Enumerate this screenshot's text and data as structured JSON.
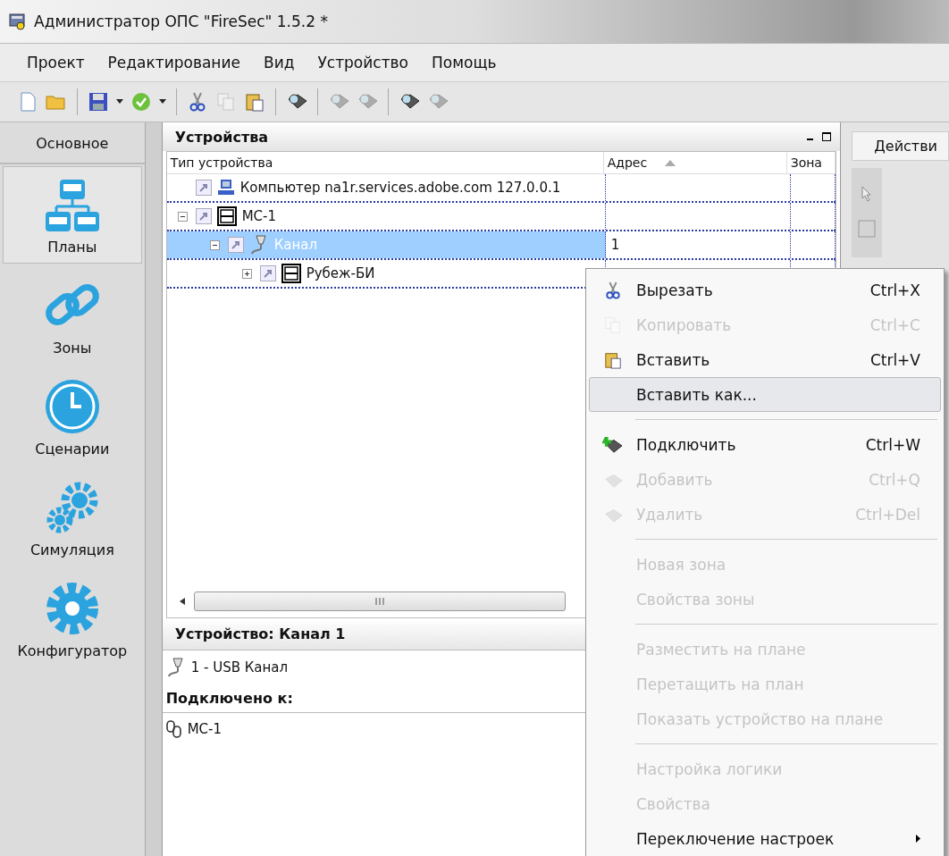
{
  "window": {
    "title": "Администратор ОПС \"FireSec\" 1.5.2 *"
  },
  "menu": [
    "Проект",
    "Редактирование",
    "Вид",
    "Устройство",
    "Помощь"
  ],
  "toolbar": [
    {
      "disabled": false
    },
    {
      "disabled": false
    },
    {
      "disabled": false
    },
    {
      "disabled": false
    },
    {
      "disabled": false
    },
    {
      "disabled": false
    },
    {
      "disabled": false
    },
    {
      "disabled": true
    },
    {
      "disabled": false
    },
    {
      "disabled": false
    },
    {
      "disabled": true
    },
    {
      "disabled": true
    },
    {
      "disabled": false
    },
    {
      "disabled": true
    }
  ],
  "sidebar": {
    "header": "Основное",
    "items": [
      {
        "label": "Планы",
        "selected": true
      },
      {
        "label": "Зоны",
        "selected": false
      },
      {
        "label": "Сценарии",
        "selected": false
      },
      {
        "label": "Симуляция",
        "selected": false
      },
      {
        "label": "Конфигуратор",
        "selected": false
      }
    ]
  },
  "devices": {
    "title": "Устройства",
    "columns": [
      {
        "label": "Тип устройства",
        "sorted": false
      },
      {
        "label": "Адрес",
        "sorted": true
      },
      {
        "label": "Зона",
        "sorted": false
      }
    ],
    "tree": [
      {
        "kind": "computer",
        "label": "Компьютер na1r.services.adobe.com 127.0.0.1",
        "selected": false
      },
      {
        "kind": "module",
        "label": "МС-1",
        "expanded": true,
        "selected": false,
        "children": [
          {
            "kind": "channel",
            "label": "Канал",
            "address": "1",
            "expanded": true,
            "selected": true,
            "children": [
              {
                "kind": "module",
                "label": "Рубеж-БИ",
                "expanded": false,
                "selected": false
              }
            ]
          }
        ]
      }
    ]
  },
  "details": {
    "title": "Устройство: Канал 1",
    "device": "1 - USB Канал",
    "connected_title": "Подключено к:",
    "connected": "МС-1"
  },
  "right_panel": {
    "tab": "Действи"
  },
  "context_menu": [
    {
      "kind": "item",
      "label": "Вырезать",
      "shortcut": "Ctrl+X",
      "disabled": false,
      "selected": false
    },
    {
      "kind": "item",
      "label": "Копировать",
      "shortcut": "Ctrl+C",
      "disabled": true,
      "selected": false
    },
    {
      "kind": "item",
      "label": "Вставить",
      "shortcut": "Ctrl+V",
      "disabled": false,
      "selected": false
    },
    {
      "kind": "item",
      "label": "Вставить как...",
      "disabled": false,
      "selected": true
    },
    {
      "kind": "separator"
    },
    {
      "kind": "item",
      "label": "Подключить",
      "shortcut": "Ctrl+W",
      "disabled": false,
      "selected": false
    },
    {
      "kind": "item",
      "label": "Добавить",
      "shortcut": "Ctrl+Q",
      "disabled": true,
      "selected": false
    },
    {
      "kind": "item",
      "label": "Удалить",
      "shortcut": "Ctrl+Del",
      "disabled": true,
      "selected": false
    },
    {
      "kind": "separator"
    },
    {
      "kind": "item",
      "label": "Новая зона",
      "disabled": true,
      "selected": false
    },
    {
      "kind": "item",
      "label": "Свойства зоны",
      "disabled": true,
      "selected": false
    },
    {
      "kind": "separator"
    },
    {
      "kind": "item",
      "label": "Разместить на плане",
      "disabled": true,
      "selected": false
    },
    {
      "kind": "item",
      "label": "Перетащить на план",
      "disabled": true,
      "selected": false
    },
    {
      "kind": "item",
      "label": "Показать устройство на плане",
      "disabled": true,
      "selected": false
    },
    {
      "kind": "separator"
    },
    {
      "kind": "item",
      "label": "Настройка логики",
      "disabled": true,
      "selected": false
    },
    {
      "kind": "item",
      "label": "Свойства",
      "disabled": true,
      "selected": false
    },
    {
      "kind": "submenu",
      "label": "Переключение настроек",
      "disabled": false,
      "selected": false
    }
  ]
}
